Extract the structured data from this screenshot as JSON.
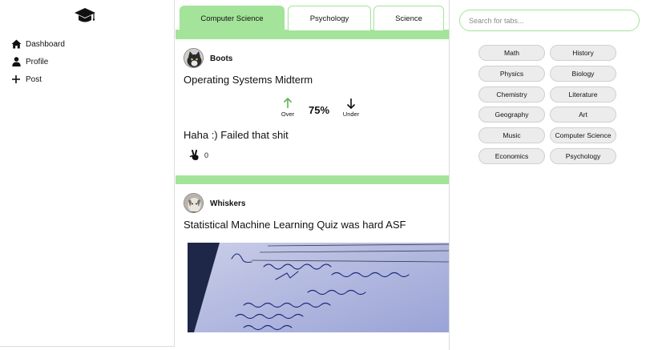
{
  "sidebar": {
    "logo_icon": "graduation-cap-icon",
    "items": [
      {
        "label": "Dashboard",
        "icon": "home-icon"
      },
      {
        "label": "Profile",
        "icon": "user-icon"
      },
      {
        "label": "Post",
        "icon": "plus-icon"
      }
    ]
  },
  "tabs": [
    {
      "label": "Computer Science",
      "active": true
    },
    {
      "label": "Psychology",
      "active": false
    },
    {
      "label": "Science",
      "active": false
    }
  ],
  "posts": [
    {
      "username": "Boots",
      "title": "Operating Systems Midterm",
      "over_label": "Over",
      "under_label": "Under",
      "percent": "75%",
      "caption": "Haha :) Failed that shit",
      "reaction_icon": "peace-hand-icon",
      "reaction_count": "0"
    },
    {
      "username": "Whiskers",
      "title": "Statistical Machine Learning Quiz was hard ASF",
      "image": "handwritten-notes-photo"
    }
  ],
  "right_panel": {
    "search_placeholder": "Search for tabs...",
    "chips": [
      "Math",
      "History",
      "Physics",
      "Biology",
      "Chemistry",
      "Literature",
      "Geography",
      "Art",
      "Music",
      "Computer Science",
      "Economics",
      "Psychology"
    ]
  },
  "colors": {
    "accent": "#a4e39a",
    "up_arrow": "#5ab552",
    "chip_bg": "#ececec"
  }
}
